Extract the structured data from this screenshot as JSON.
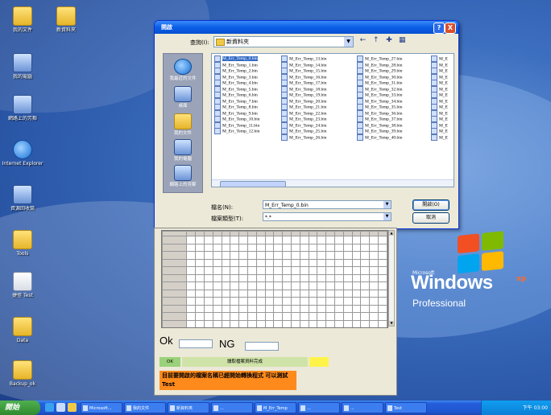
{
  "desktop": {
    "icons": [
      {
        "label": "我的文件",
        "kind": "folder",
        "icon": "my-documents-icon"
      },
      {
        "label": "新資料夾",
        "kind": "folder",
        "icon": "folder-icon"
      },
      {
        "label": "我的電腦",
        "kind": "pc",
        "icon": "my-computer-icon"
      },
      {
        "label": "網路上的芳鄰",
        "kind": "pc",
        "icon": "network-places-icon"
      },
      {
        "label": "Internet Explorer",
        "kind": "globe",
        "icon": "internet-explorer-icon"
      },
      {
        "label": "資源回收筒",
        "kind": "pc",
        "icon": "recycle-bin-icon"
      },
      {
        "label": "Tools",
        "kind": "folder",
        "icon": "folder-icon"
      },
      {
        "label": "捷徑 Test",
        "kind": "doc",
        "icon": "shortcut-icon"
      },
      {
        "label": "Data",
        "kind": "folder",
        "icon": "folder-icon"
      },
      {
        "label": "Backup_ok",
        "kind": "folder",
        "icon": "folder-icon"
      }
    ],
    "logo": {
      "brand": "Microsoft",
      "name": "Windows",
      "edition": "Professional",
      "xp": "xp"
    }
  },
  "dialog": {
    "title": "開啟",
    "help": "?",
    "close": "X",
    "look_in_label": "查詢(I):",
    "look_in_value": "新資料夾",
    "toolbar_icons": [
      "back-icon",
      "up-folder-icon",
      "new-folder-icon",
      "views-icon"
    ],
    "places": [
      {
        "label": "我最近的文件",
        "icon": "recent-documents-icon"
      },
      {
        "label": "桌面",
        "icon": "desktop-icon"
      },
      {
        "label": "我的文件",
        "icon": "my-documents-icon"
      },
      {
        "label": "我的電腦",
        "icon": "my-computer-icon"
      },
      {
        "label": "網路上的芳鄰",
        "icon": "network-places-icon"
      }
    ],
    "files_col1": [
      "M_Err_Temp_0.bin",
      "M_Err_Temp_1.bin",
      "M_Err_Temp_2.bin",
      "M_Err_Temp_3.bin",
      "M_Err_Temp_4.bin",
      "M_Err_Temp_5.bin",
      "M_Err_Temp_6.bin",
      "M_Err_Temp_7.bin",
      "M_Err_Temp_8.bin",
      "M_Err_Temp_9.bin",
      "M_Err_Temp_10.bin",
      "M_Err_Temp_11.bin",
      "M_Err_Temp_12.bin"
    ],
    "files_col2": [
      "M_Err_Temp_13.bin",
      "M_Err_Temp_14.bin",
      "M_Err_Temp_15.bin",
      "M_Err_Temp_16.bin",
      "M_Err_Temp_17.bin",
      "M_Err_Temp_18.bin",
      "M_Err_Temp_19.bin",
      "M_Err_Temp_20.bin",
      "M_Err_Temp_21.bin",
      "M_Err_Temp_22.bin",
      "M_Err_Temp_23.bin",
      "M_Err_Temp_24.bin",
      "M_Err_Temp_25.bin",
      "M_Err_Temp_26.bin"
    ],
    "files_col3": [
      "M_Err_Temp_27.bin",
      "M_Err_Temp_28.bin",
      "M_Err_Temp_29.bin",
      "M_Err_Temp_30.bin",
      "M_Err_Temp_31.bin",
      "M_Err_Temp_32.bin",
      "M_Err_Temp_33.bin",
      "M_Err_Temp_34.bin",
      "M_Err_Temp_35.bin",
      "M_Err_Temp_36.bin",
      "M_Err_Temp_37.bin",
      "M_Err_Temp_38.bin",
      "M_Err_Temp_39.bin",
      "M_Err_Temp_40.bin"
    ],
    "files_col4": [
      "M_E",
      "M_E",
      "M_E",
      "M_E",
      "M_E",
      "M_E",
      "M_E",
      "M_E",
      "M_E",
      "M_E",
      "M_E",
      "M_E",
      "M_E",
      "M_E"
    ],
    "selected_file": "M_Err_Temp_0.bin",
    "filename_label": "檔名(N):",
    "filename_value": "M_Err_Temp_0.bin",
    "filetype_label": "檔案類型(T):",
    "filetype_value": "*.*",
    "open_label": "開啟(O)",
    "cancel_label": "取消"
  },
  "app": {
    "ok_label": "Ok",
    "ng_label": "NG",
    "status_green": "OK",
    "status_mid": "讀取檔案資料完成",
    "status_yellow": "",
    "message": "目前要開啟的檔案名稱已經開始轉換程式 可以測試 Test"
  },
  "taskbar": {
    "start_label": "開始",
    "quick_launch": [
      "ie-icon",
      "desktop-icon",
      "folder-icon"
    ],
    "items": [
      "Microsoft...",
      "我的文件",
      "新資料夾",
      "...",
      "M_Err_Temp",
      "...",
      "...",
      "Test"
    ],
    "time": "下午 03:00"
  }
}
